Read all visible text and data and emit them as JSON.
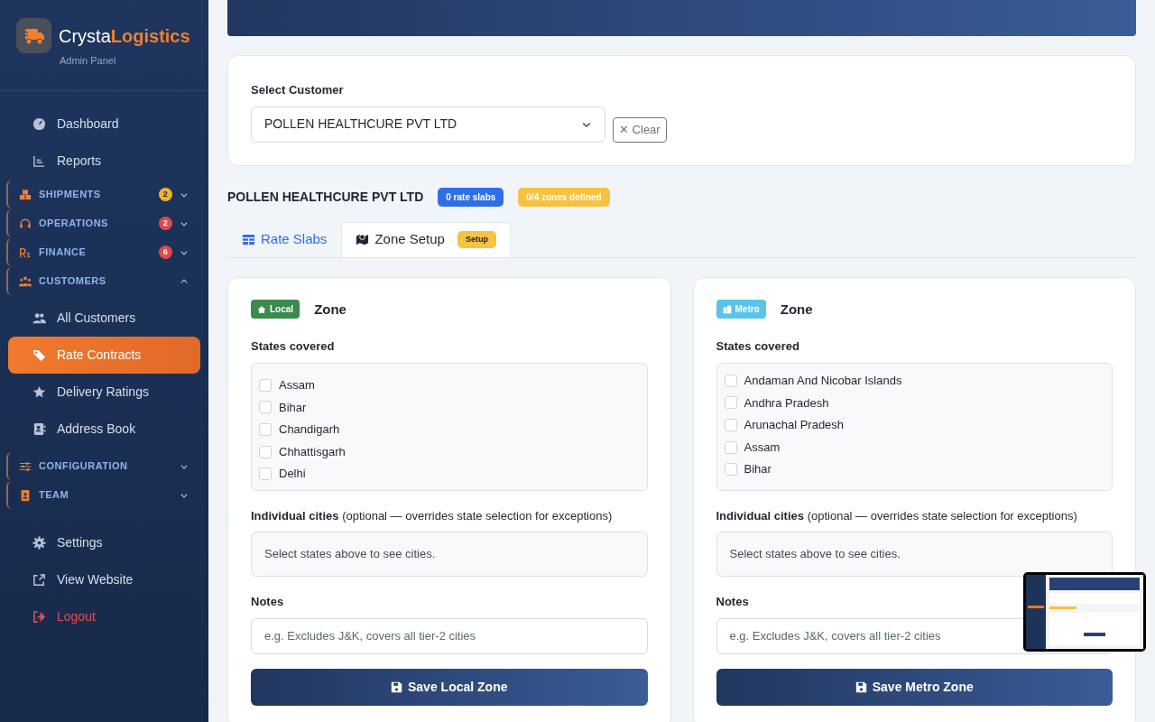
{
  "brand": {
    "name_part1": "Crysta",
    "name_part2": "Logistics",
    "subtitle": "Admin Panel"
  },
  "sidebar": {
    "items": [
      {
        "kind": "link",
        "label": "Dashboard",
        "selected": false
      },
      {
        "kind": "link",
        "label": "Reports",
        "selected": false
      },
      {
        "kind": "section",
        "label": "SHIPMENTS",
        "badge": "2",
        "color": "#f0b429",
        "expanded": false
      },
      {
        "kind": "section",
        "label": "OPERATIONS",
        "badge": "2",
        "color": "#e04a4a",
        "expanded": false
      },
      {
        "kind": "section",
        "label": "FINANCE",
        "badge": "6",
        "color": "#e04a4a",
        "expanded": false
      },
      {
        "kind": "section",
        "label": "CUSTOMERS",
        "expanded": true,
        "children": [
          {
            "kind": "link",
            "label": "All Customers",
            "selected": false
          },
          {
            "kind": "link",
            "label": "Rate Contracts",
            "selected": true
          },
          {
            "kind": "link",
            "label": "Delivery Ratings",
            "selected": false
          },
          {
            "kind": "link",
            "label": "Address Book",
            "selected": false
          }
        ]
      },
      {
        "kind": "section",
        "label": "CONFIGURATION",
        "expanded": false
      },
      {
        "kind": "section",
        "label": "TEAM",
        "expanded": false
      },
      {
        "kind": "link",
        "label": "Settings",
        "selected": false
      },
      {
        "kind": "link",
        "label": "View Website",
        "selected": false
      },
      {
        "kind": "logout",
        "label": "Logout",
        "selected": false
      }
    ]
  },
  "customer_select": {
    "label": "Select Customer",
    "value": "POLLEN HEALTHCURE PVT LTD",
    "clear_button": "✕ Clear"
  },
  "customer": {
    "name": "POLLEN HEALTHCURE PVT LTD",
    "badges": [
      {
        "text": "0 rate slabs",
        "color": "#2f6fe6"
      },
      {
        "text": "0/4 zones defined",
        "color": "#f5c242"
      }
    ]
  },
  "tabs": [
    {
      "label": "Rate Slabs",
      "selected": false
    },
    {
      "label": "Zone Setup",
      "selected": true,
      "badge": "Setup"
    }
  ],
  "zones": [
    {
      "tag": "Local",
      "color": "#3b8a4e",
      "title": "Zone",
      "states_label": "States covered",
      "states": [
        {
          "label": "Assam",
          "checked": false
        },
        {
          "label": "Bihar",
          "checked": false
        },
        {
          "label": "Chandigarh",
          "checked": false
        },
        {
          "label": "Chhattisgarh",
          "checked": false
        },
        {
          "label": "Delhi",
          "checked": false
        }
      ],
      "cities_label": "**Individual cities** (optional — overrides state selection for exceptions)",
      "cities_hint": "Select states above to see cities.",
      "notes_label": "Notes",
      "notes_placeholder": "e.g. Excludes J&K, covers all tier-2 cities",
      "save_button": "Save Local Zone"
    },
    {
      "tag": "Metro",
      "color": "#5bc3ea",
      "title": "Zone",
      "states_label": "States covered",
      "states": [
        {
          "label": "Andaman And Nicobar Islands",
          "checked": false
        },
        {
          "label": "Andhra Pradesh",
          "checked": false
        },
        {
          "label": "Arunachal Pradesh",
          "checked": false
        },
        {
          "label": "Assam",
          "checked": false
        },
        {
          "label": "Bihar",
          "checked": false
        }
      ],
      "cities_label": "**Individual cities** (optional — overrides state selection for exceptions)",
      "cities_hint": "Select states above to see cities.",
      "notes_label": "Notes",
      "notes_placeholder": "e.g. Excludes J&K, covers all tier-2 cities",
      "save_button": "Save Metro Zone"
    }
  ]
}
